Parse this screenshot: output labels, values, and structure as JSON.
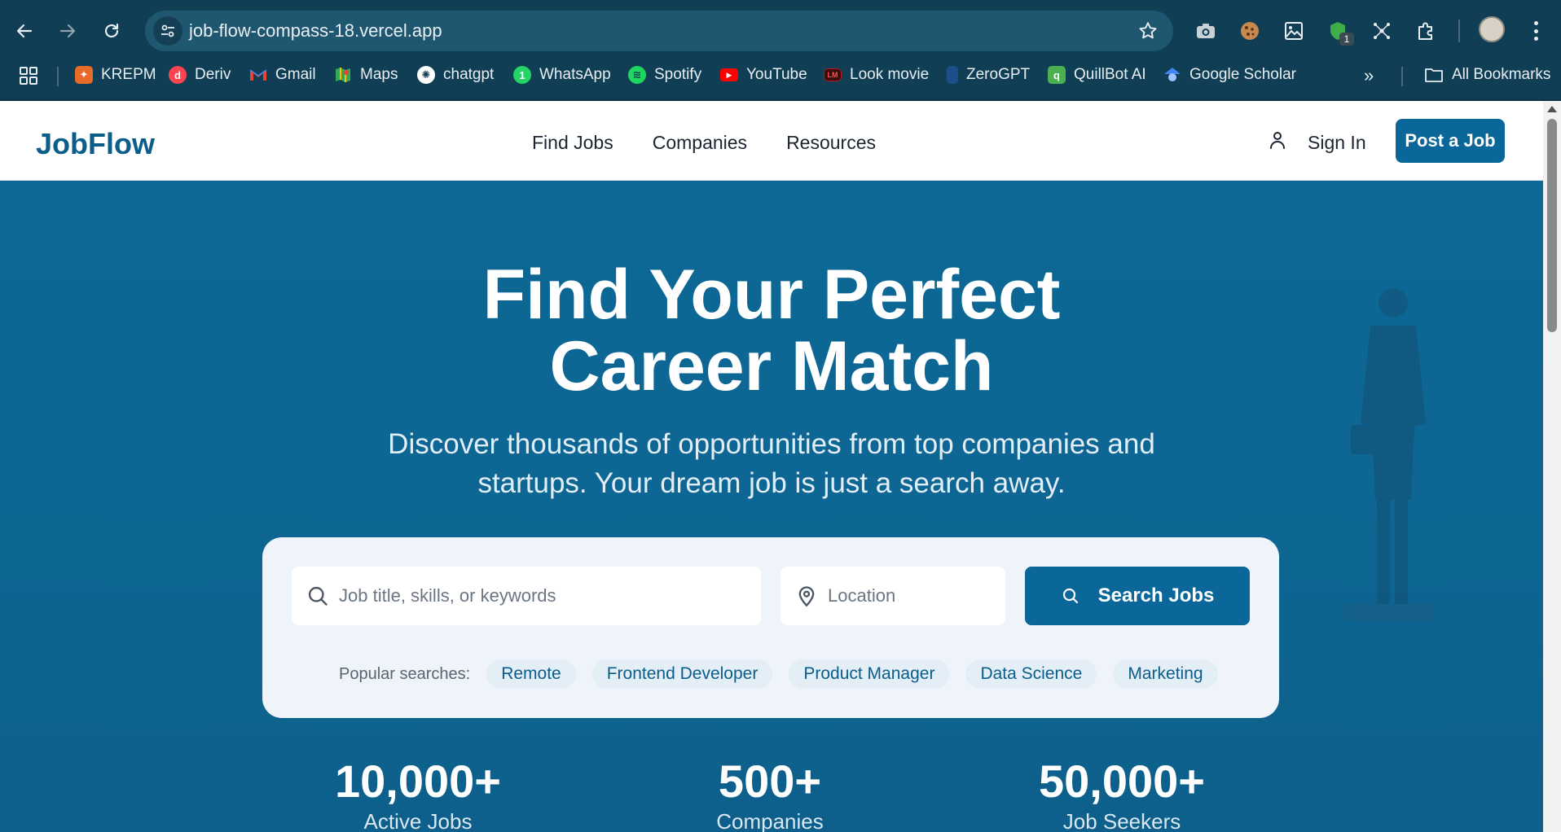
{
  "browser": {
    "url": "job-flow-compass-18.vercel.app",
    "extension_badge": "1",
    "bookmarks": [
      {
        "label": "KREPM",
        "icon": "krepm-icon",
        "color": "#e86b2a"
      },
      {
        "label": "Deriv",
        "icon": "deriv-icon",
        "color": "#ff444f"
      },
      {
        "label": "Gmail",
        "icon": "gmail-icon",
        "color": "#ea4335"
      },
      {
        "label": "Maps",
        "icon": "maps-icon",
        "color": "#34a853"
      },
      {
        "label": "chatgpt",
        "icon": "chatgpt-icon",
        "color": "#ffffff"
      },
      {
        "label": "WhatsApp",
        "icon": "whatsapp-icon",
        "color": "#25d366"
      },
      {
        "label": "Spotify",
        "icon": "spotify-icon",
        "color": "#1ed760"
      },
      {
        "label": "YouTube",
        "icon": "youtube-icon",
        "color": "#ff0000"
      },
      {
        "label": "Look movie",
        "icon": "lookmovie-icon",
        "color": "#b71c1c"
      },
      {
        "label": "ZeroGPT",
        "icon": "zerogpt-icon",
        "color": "#1d4e89"
      },
      {
        "label": "QuillBot AI",
        "icon": "quillbot-icon",
        "color": "#4caf50"
      },
      {
        "label": "Google Scholar",
        "icon": "google-scholar-icon",
        "color": "#4285f4"
      }
    ],
    "all_bookmarks": "All Bookmarks"
  },
  "site": {
    "logo": "JobFlow",
    "nav": [
      "Find Jobs",
      "Companies",
      "Resources"
    ],
    "sign_in": "Sign In",
    "post_job": "Post a Job"
  },
  "hero": {
    "title_line1": "Find Your Perfect",
    "title_line2": "Career Match",
    "subtitle_line1": "Discover thousands of opportunities from top companies and",
    "subtitle_line2": "startups. Your dream job is just a search away."
  },
  "search": {
    "keywords_placeholder": "Job title, skills, or keywords",
    "location_placeholder": "Location",
    "button": "Search Jobs",
    "popular_label": "Popular searches:",
    "popular": [
      "Remote",
      "Frontend Developer",
      "Product Manager",
      "Data Science",
      "Marketing"
    ]
  },
  "stats": [
    {
      "value": "10,000+",
      "label": "Active Jobs"
    },
    {
      "value": "500+",
      "label": "Companies"
    },
    {
      "value": "50,000+",
      "label": "Job Seekers"
    }
  ],
  "colors": {
    "brand": "#0b679a",
    "hero_bg": "#0d6592",
    "chrome": "#0f3e55"
  }
}
